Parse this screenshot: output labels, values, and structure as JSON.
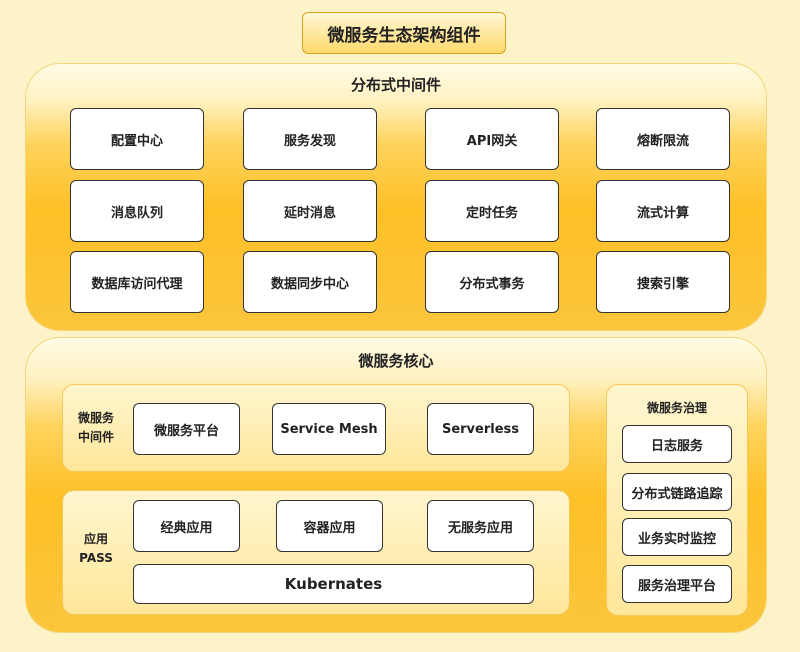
{
  "title": "微服务生态架构组件",
  "middleware": {
    "title": "分布式中间件",
    "items": [
      "配置中心",
      "服务发现",
      "API网关",
      "熔断限流",
      "消息队列",
      "延时消息",
      "定时任务",
      "流式计算",
      "数据库访问代理",
      "数据同步中心",
      "分布式事务",
      "搜索引擎"
    ]
  },
  "core": {
    "title": "微服务核心",
    "ms_middleware": {
      "label_line1": "微服务",
      "label_line2": "中间件",
      "items": [
        "微服务平台",
        "Service Mesh",
        "Serverless"
      ]
    },
    "app_pass": {
      "label_line1": "应用",
      "label_line2": "PASS",
      "items": [
        "经典应用",
        "容器应用",
        "无服务应用"
      ],
      "base": "Kubernates"
    },
    "governance": {
      "title": "微服务治理",
      "items": [
        "日志服务",
        "分布式链路追踪",
        "业务实时监控",
        "服务治理平台"
      ]
    }
  }
}
